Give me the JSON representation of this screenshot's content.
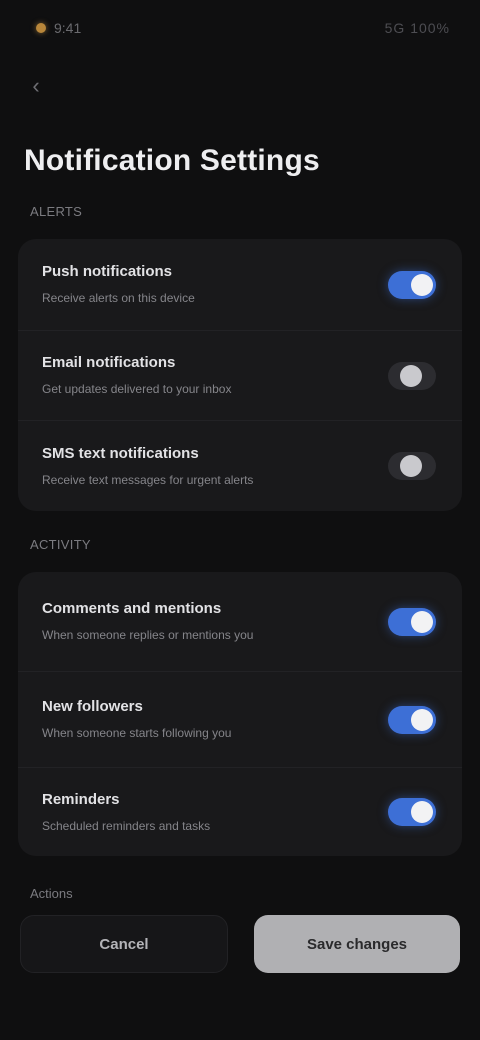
{
  "status_bar": {
    "time": "9:41",
    "right": "5G 100%"
  },
  "nav": {
    "back_icon": "chevron-left-icon",
    "back_glyph": "‹"
  },
  "page": {
    "title": "Notification Settings"
  },
  "sections": [
    {
      "header": "ALERTS",
      "rows": [
        {
          "title": "Push notifications",
          "subtitle": "Receive alerts on this device",
          "on": true
        },
        {
          "title": "Email notifications",
          "subtitle": "Get updates delivered to your inbox",
          "on": false
        },
        {
          "title": "SMS text notifications",
          "subtitle": "Receive text messages for urgent alerts",
          "on": false
        }
      ]
    },
    {
      "header": "ACTIVITY",
      "rows": [
        {
          "title": "Comments and mentions",
          "subtitle": "When someone replies or mentions you",
          "on": true
        },
        {
          "title": "New followers",
          "subtitle": "When someone starts following you",
          "on": true
        },
        {
          "title": "Reminders",
          "subtitle": "Scheduled reminders and tasks",
          "on": true
        }
      ]
    }
  ],
  "footer": {
    "label": "Actions",
    "cancel_label": "Cancel",
    "save_label": "Save changes"
  },
  "colors": {
    "accent": "#3d6fd6",
    "background": "#0f0f10",
    "card": "#19191b"
  }
}
